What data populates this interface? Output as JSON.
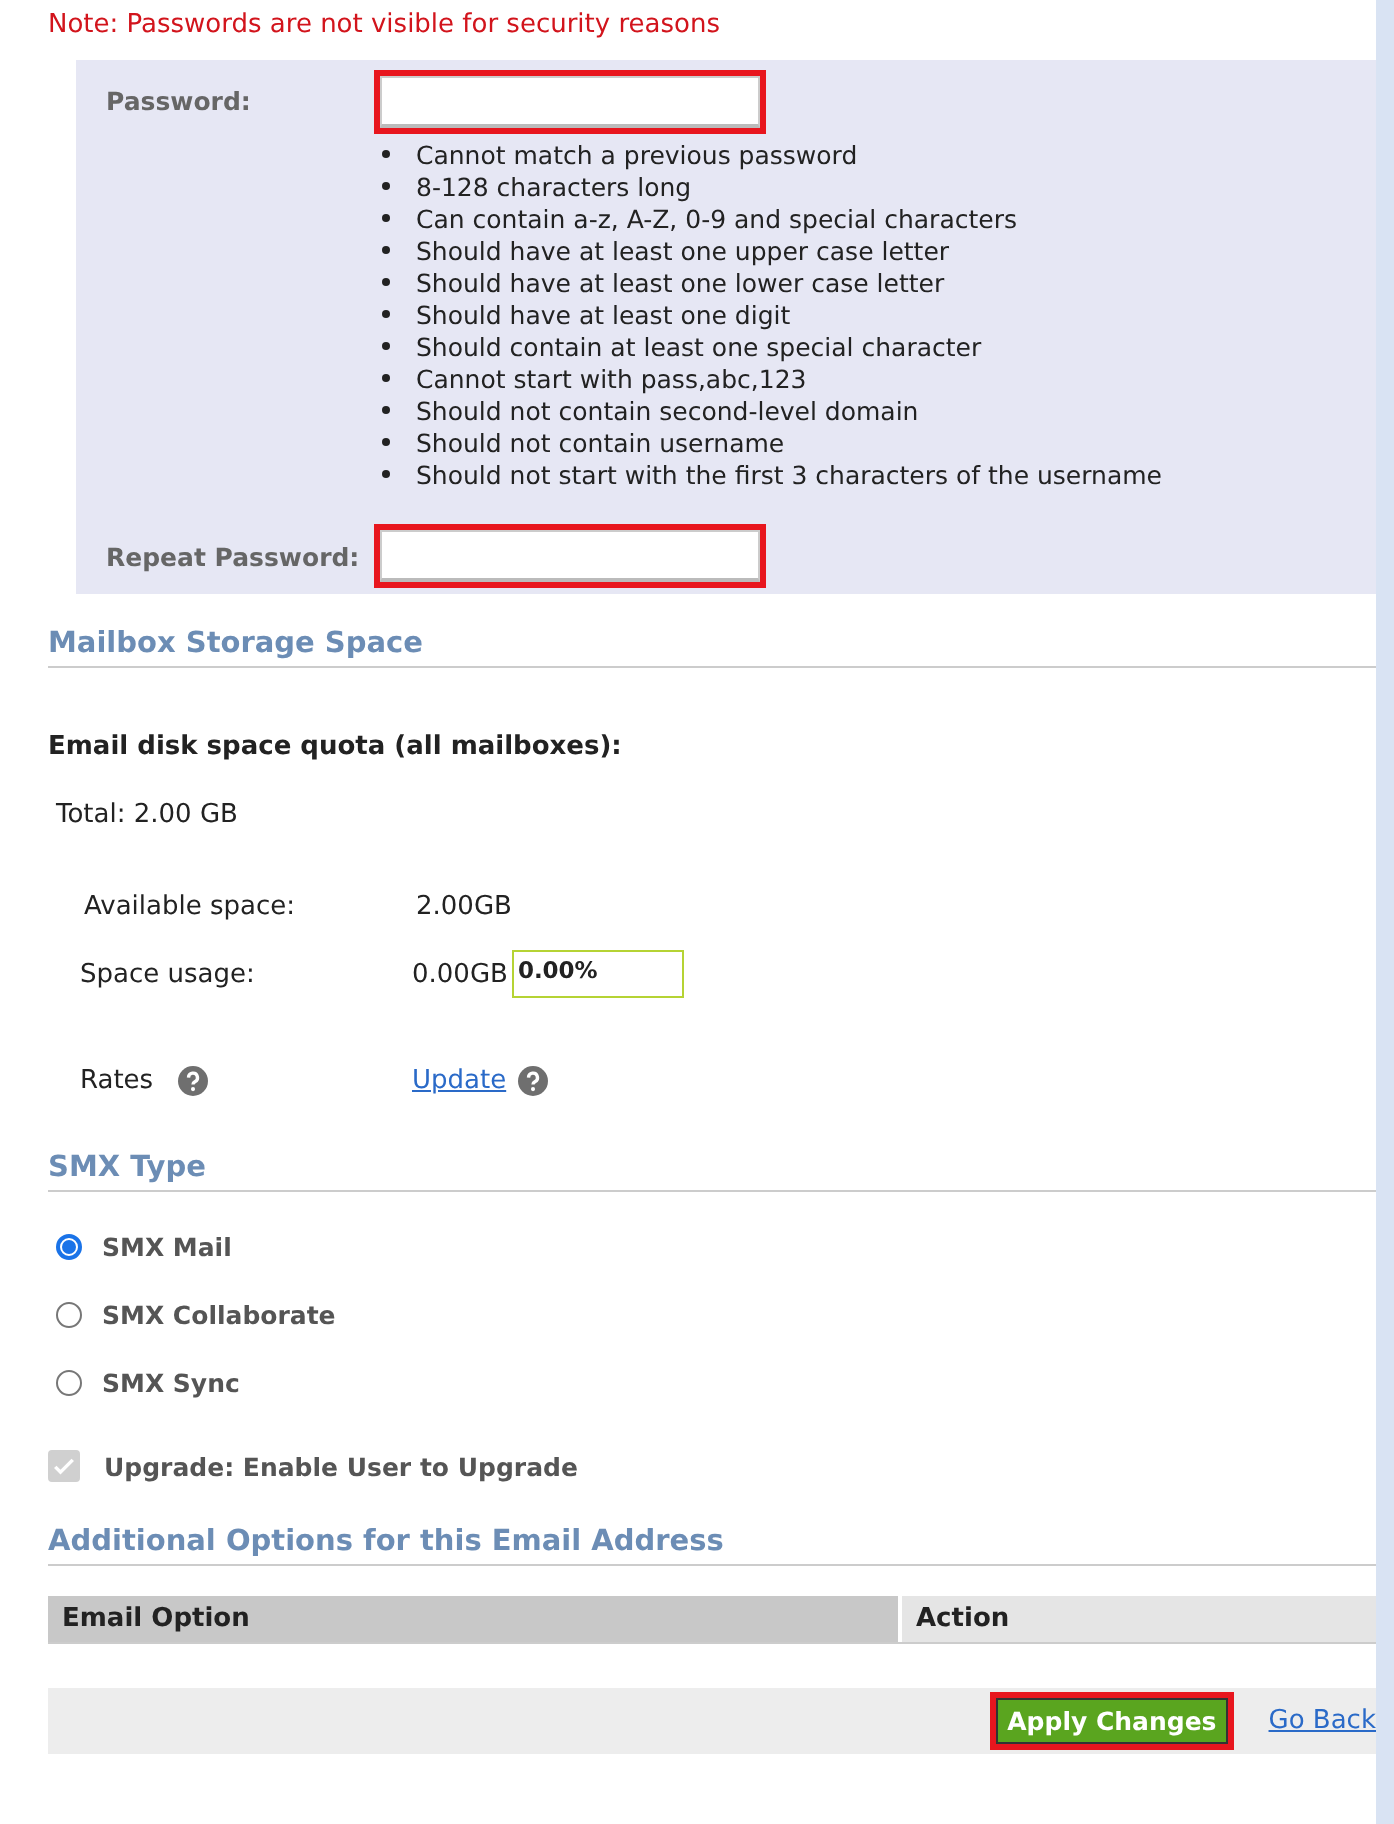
{
  "note": "Note: Passwords are not visible for security reasons",
  "password": {
    "label": "Password:",
    "highlighted": true,
    "rules": [
      "Cannot match a previous password",
      "8-128 characters long",
      "Can contain a-z, A-Z, 0-9 and special characters",
      "Should have at least one upper case letter",
      "Should have at least one lower case letter",
      "Should have at least one digit",
      "Should contain at least one special character",
      "Cannot start with pass,abc,123",
      "Should not contain second-level domain",
      "Should not contain username",
      "Should not start with the first 3 characters of the username"
    ]
  },
  "repeat_password": {
    "label": "Repeat Password:",
    "highlighted": true
  },
  "storage": {
    "heading": "Mailbox Storage Space",
    "quota_label": "Email disk space quota (all mailboxes):",
    "total": "Total: 2.00 GB",
    "available_label": "Available space:",
    "available_value": "2.00GB",
    "usage_label": "Space usage:",
    "usage_value": "0.00GB",
    "usage_percent": "0.00%",
    "rates_label": "Rates",
    "update_link": "Update"
  },
  "smx_type": {
    "heading": "SMX Type",
    "options": [
      {
        "label": "SMX Mail",
        "selected": true
      },
      {
        "label": "SMX Collaborate",
        "selected": false
      },
      {
        "label": "SMX Sync",
        "selected": false
      }
    ],
    "upgrade": {
      "label": "Upgrade: Enable User to Upgrade",
      "checked": true,
      "disabled": true
    }
  },
  "additional": {
    "heading": "Additional Options for this Email Address",
    "columns": [
      "Email Option",
      "Action"
    ]
  },
  "footer": {
    "apply": {
      "label": "Apply Changes",
      "highlighted": true
    },
    "back": "Go Back"
  }
}
